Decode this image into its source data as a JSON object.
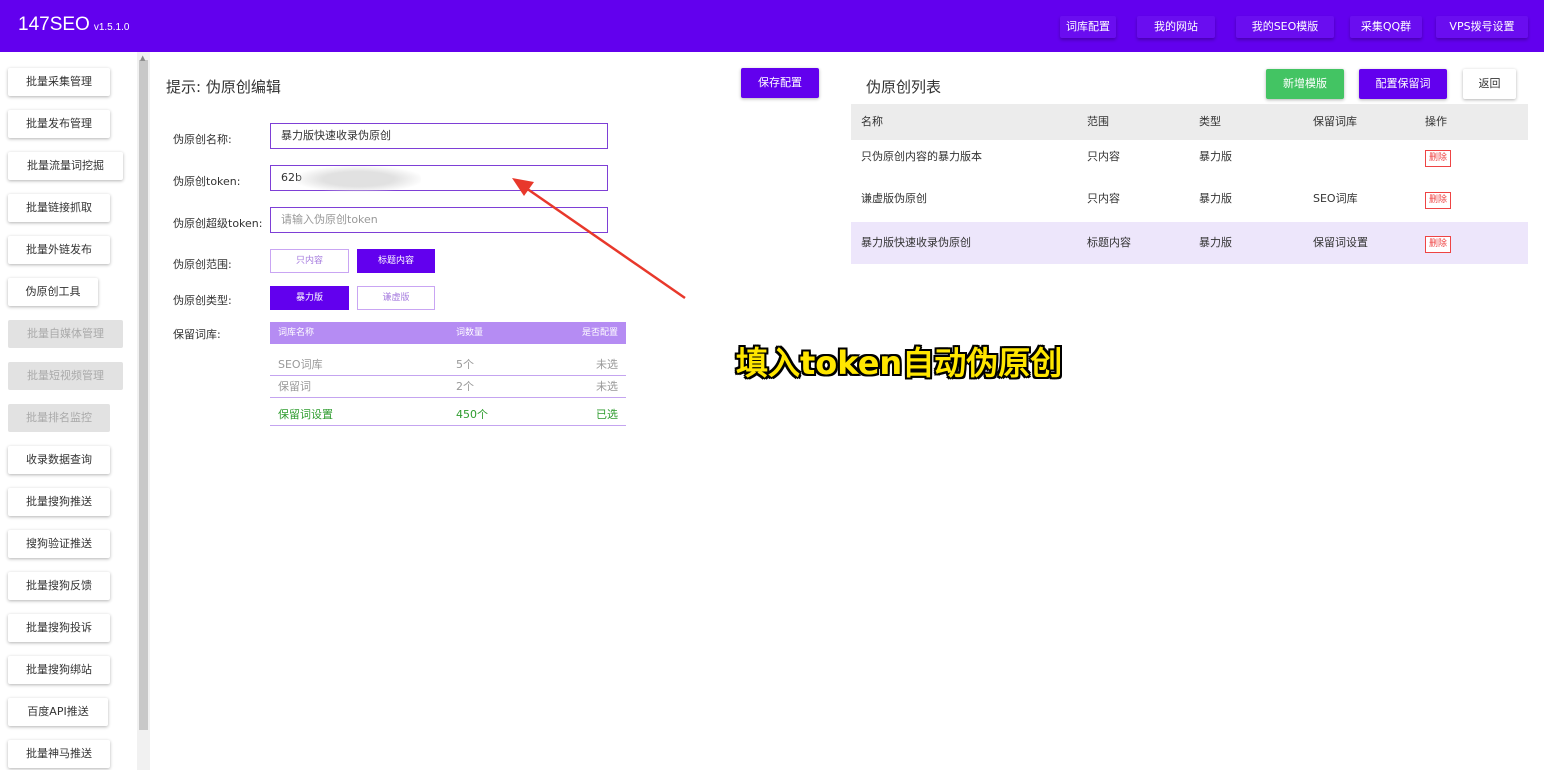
{
  "app": {
    "name": "147SEO",
    "version": "v1.5.1.0"
  },
  "header_nav": [
    "词库配置",
    "我的网站",
    "我的SEO模版",
    "采集QQ群",
    "VPS拨号设置"
  ],
  "sidebar": {
    "items": [
      {
        "label": "批量采集管理",
        "disabled": false
      },
      {
        "label": "批量发布管理",
        "disabled": false
      },
      {
        "label": "批量流量词挖掘",
        "disabled": false
      },
      {
        "label": "批量链接抓取",
        "disabled": false
      },
      {
        "label": "批量外链发布",
        "disabled": false
      },
      {
        "label": "伪原创工具",
        "disabled": false
      },
      {
        "label": "批量自媒体管理",
        "disabled": true
      },
      {
        "label": "批量短视频管理",
        "disabled": true
      },
      {
        "label": "批量排名监控",
        "disabled": true
      },
      {
        "label": "收录数据查询",
        "disabled": false
      },
      {
        "label": "批量搜狗推送",
        "disabled": false
      },
      {
        "label": "搜狗验证推送",
        "disabled": false
      },
      {
        "label": "批量搜狗反馈",
        "disabled": false
      },
      {
        "label": "批量搜狗投诉",
        "disabled": false
      },
      {
        "label": "批量搜狗绑站",
        "disabled": false
      },
      {
        "label": "百度API推送",
        "disabled": false
      },
      {
        "label": "批量神马推送",
        "disabled": false
      }
    ]
  },
  "editor": {
    "title": "提示: 伪原创编辑",
    "save_label": "保存配置",
    "name_label": "伪原创名称:",
    "name_value": "暴力版快速收录伪原创",
    "token_label": "伪原创token:",
    "token_value": "62b",
    "super_token_label": "伪原创超级token:",
    "super_token_placeholder": "请输入伪原创token",
    "scope_label": "伪原创范围:",
    "scope_options": [
      "只内容",
      "标题内容"
    ],
    "scope_selected": "标题内容",
    "type_label": "伪原创类型:",
    "type_options": [
      "暴力版",
      "谦虚版"
    ],
    "type_selected": "暴力版",
    "dict_label": "保留词库:",
    "dict_columns": [
      "词库名称",
      "词数量",
      "是否配置"
    ],
    "dict_rows": [
      {
        "name": "SEO词库",
        "count": "5个",
        "status": "未选",
        "selected": false
      },
      {
        "name": "保留词",
        "count": "2个",
        "status": "未选",
        "selected": false
      },
      {
        "name": "保留词设置",
        "count": "450个",
        "status": "已选",
        "selected": true
      }
    ]
  },
  "list": {
    "title": "伪原创列表",
    "add_label": "新增模版",
    "config_label": "配置保留词",
    "back_label": "返回",
    "columns": [
      "名称",
      "范围",
      "类型",
      "保留词库",
      "操作"
    ],
    "rows": [
      {
        "name": "只伪原创内容的暴力版本",
        "scope": "只内容",
        "type": "暴力版",
        "dict": "",
        "action": "删除"
      },
      {
        "name": "谦虚版伪原创",
        "scope": "只内容",
        "type": "暴力版",
        "dict": "SEO词库",
        "action": "删除"
      },
      {
        "name": "暴力版快速收录伪原创",
        "scope": "标题内容",
        "type": "暴力版",
        "dict": "保留词设置",
        "action": "删除"
      }
    ]
  },
  "annotation": {
    "text": "填入token自动伪原创",
    "color": "#ffe600",
    "arrow_color": "#e8382b"
  },
  "colors": {
    "brand": "#6200ee",
    "success": "#43c463",
    "danger": "#e44444",
    "highlight_row": "#ede6fb"
  }
}
